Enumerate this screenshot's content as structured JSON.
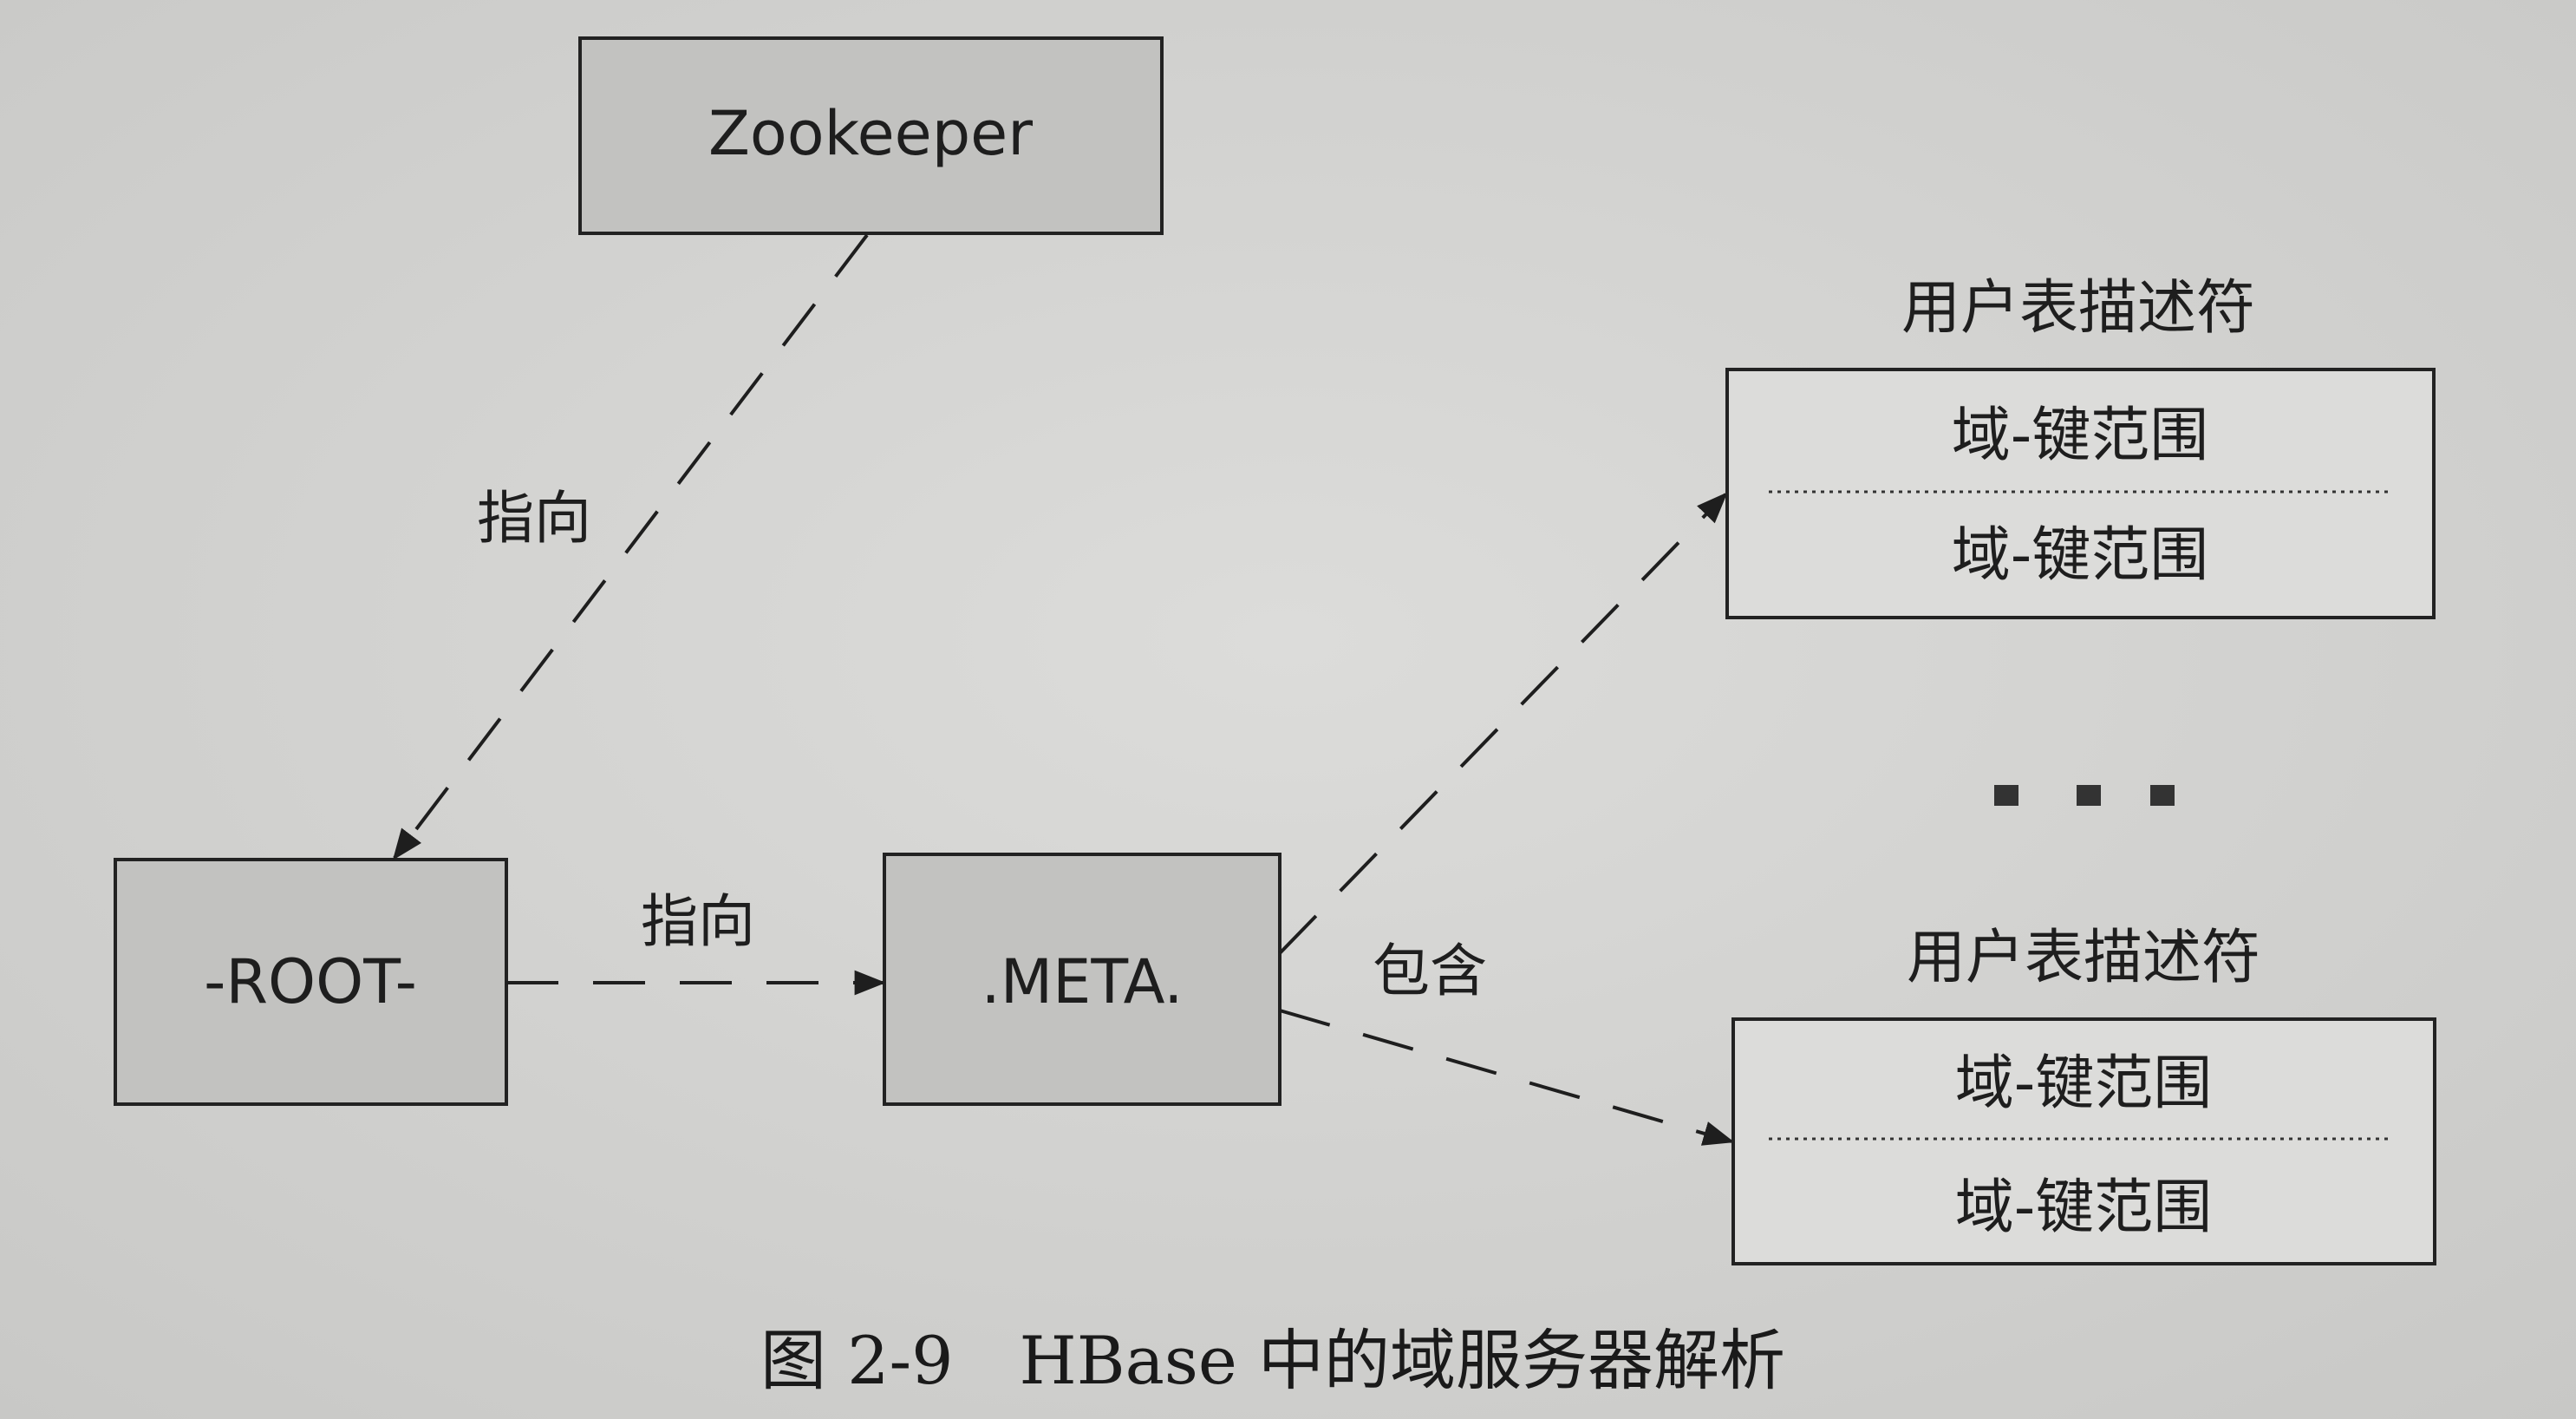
{
  "nodes": {
    "zookeeper": "Zookeeper",
    "root": "-ROOT-",
    "meta": ".META."
  },
  "edges": {
    "zookeeper_to_root": "指向",
    "root_to_meta": "指向",
    "meta_to_tables": "包含"
  },
  "tables": [
    {
      "title": "用户表描述符",
      "rows": [
        "域-键范围",
        "域-键范围"
      ]
    },
    {
      "title": "用户表描述符",
      "rows": [
        "域-键范围",
        "域-键范围"
      ]
    }
  ],
  "ellipsis": "...",
  "caption": "图 2-9　HBase 中的域服务器解析",
  "colors": {
    "background": "#d4d4d2",
    "node_fill": "#c2c2c0",
    "table_fill": "#dcdcda",
    "ink": "#1e1e1e"
  }
}
